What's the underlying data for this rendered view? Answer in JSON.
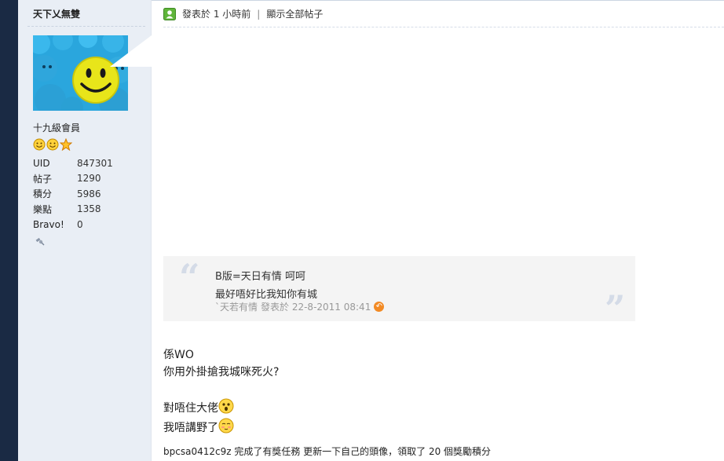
{
  "user": {
    "name": "天下乂無雙",
    "rank": "十九級會員",
    "stats": [
      {
        "label": "UID",
        "value": "847301"
      },
      {
        "label": "帖子",
        "value": "1290"
      },
      {
        "label": "積分",
        "value": "5986"
      },
      {
        "label": "樂點",
        "value": "1358"
      },
      {
        "label": "Bravo!",
        "value": "0"
      }
    ]
  },
  "post": {
    "posted_label": "發表於 1 小時前",
    "separator": "|",
    "show_all_label": "顯示全部帖子",
    "quote": {
      "line1": "B版=天日有情 呵呵",
      "line2": "最好唔好比我知你有城",
      "author": "`天若有情",
      "posted_at": "發表於 22-8-2011 08:41"
    },
    "lines": [
      "係WO",
      "你用外掛搶我城咪死火?",
      "對唔住大佬",
      "我唔講野了"
    ],
    "footer": "bpcsa0412c9z 完成了有獎任務 更新一下自己的頭像，領取了 20 個獎勵積分"
  },
  "icons": {
    "post_icon": "user-post-icon",
    "back_icon": "jump-back-icon",
    "surprised_emoji": "surprised-emoji-icon",
    "shy_emoji": "shy-emoji-icon"
  },
  "colors": {
    "left_bar": "#1a2a44",
    "panel_bg": "#e9eef5",
    "quote_bg": "#f4f4f4",
    "accent_orange": "#f28a24"
  }
}
